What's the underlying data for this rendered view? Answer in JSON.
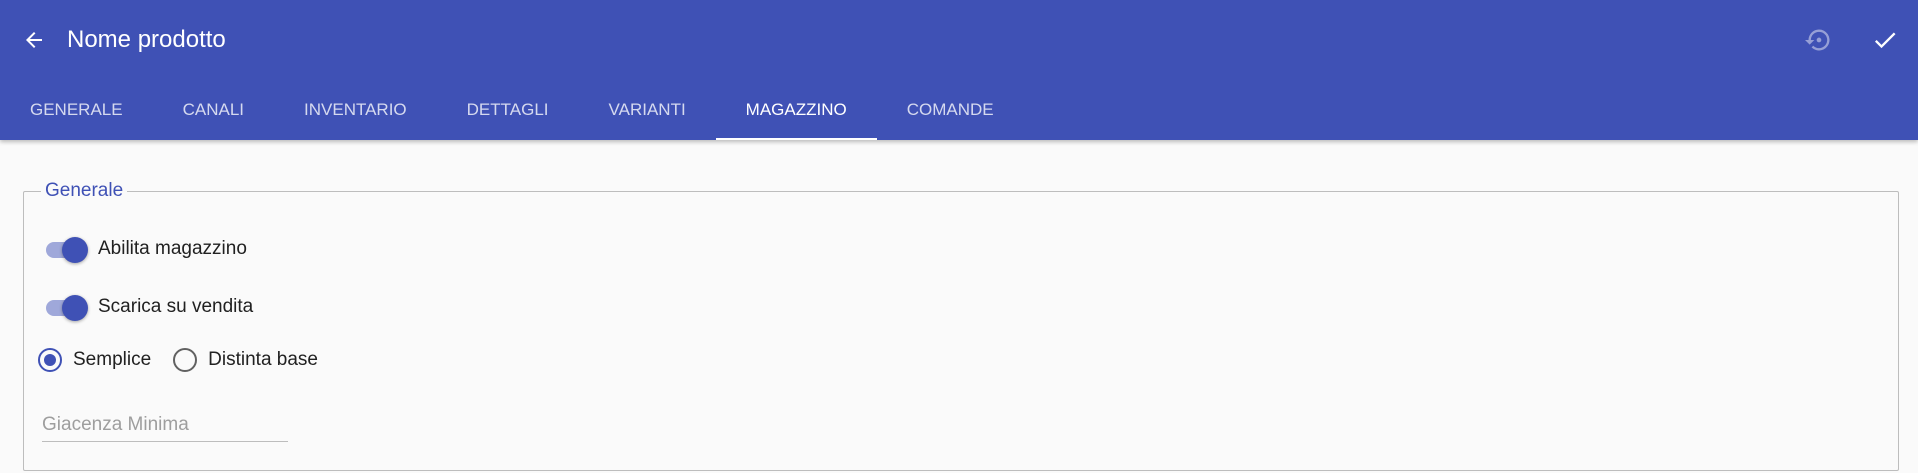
{
  "header": {
    "title": "Nome prodotto",
    "back_icon": "arrow-left-icon",
    "reset_icon": "restore-icon",
    "save_icon": "check-icon"
  },
  "tabs": [
    {
      "label": "GENERALE",
      "active": false
    },
    {
      "label": "CANALI",
      "active": false
    },
    {
      "label": "INVENTARIO",
      "active": false
    },
    {
      "label": "DETTAGLI",
      "active": false
    },
    {
      "label": "VARIANTI",
      "active": false
    },
    {
      "label": "MAGAZZINO",
      "active": true
    },
    {
      "label": "COMANDE",
      "active": false
    }
  ],
  "section": {
    "legend": "Generale",
    "toggles": [
      {
        "label": "Abilita magazzino",
        "on": true
      },
      {
        "label": "Scarica su vendita",
        "on": true
      }
    ],
    "radios": [
      {
        "label": "Semplice",
        "checked": true
      },
      {
        "label": "Distinta base",
        "checked": false
      }
    ],
    "min_stock": {
      "placeholder": "Giacenza Minima",
      "value": ""
    }
  },
  "colors": {
    "primary": "#3f51b5",
    "toggle_track": "#9fa8da",
    "background": "#fafafa"
  }
}
